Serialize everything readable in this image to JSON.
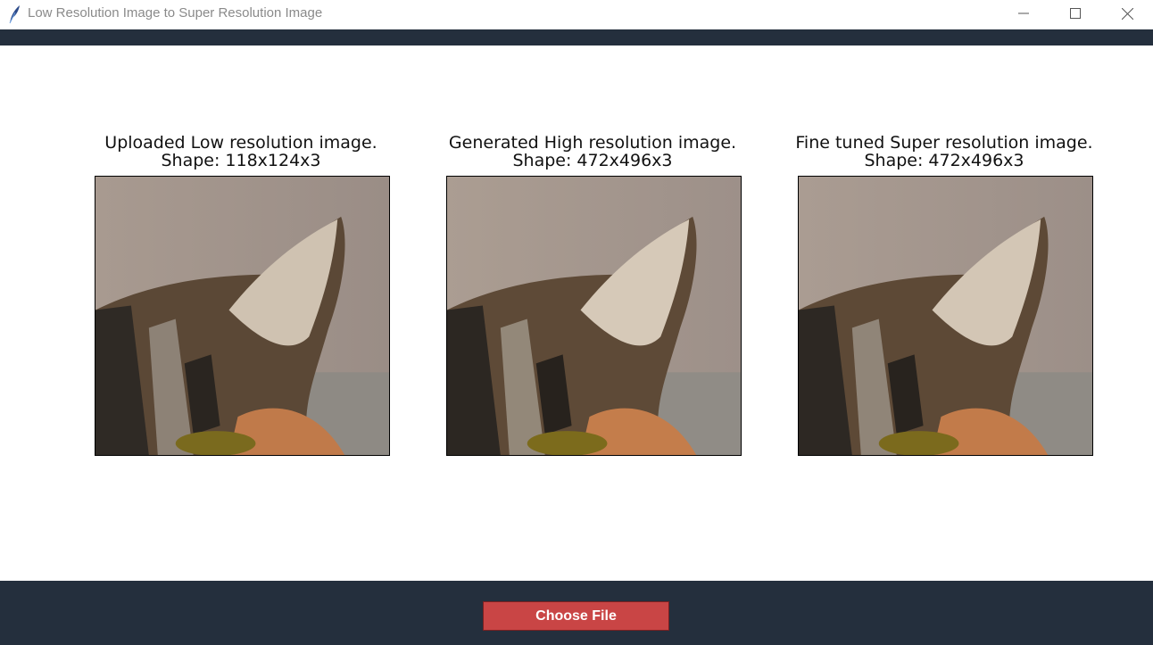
{
  "window": {
    "title": "Low Resolution Image to Super Resolution Image",
    "controls": {
      "minimize_icon": "minimize-icon",
      "maximize_icon": "maximize-icon",
      "close_icon": "close-icon"
    },
    "app_icon": "feather-icon"
  },
  "panels": [
    {
      "caption_line1": "Uploaded Low resolution image.",
      "caption_line2": "Shape: 118x124x3",
      "image": "cat-ear-low-res"
    },
    {
      "caption_line1": "Generated High resolution image.",
      "caption_line2": "Shape: 472x496x3",
      "image": "cat-ear-high-res"
    },
    {
      "caption_line1": "Fine tuned Super resolution image.",
      "caption_line2": "Shape: 472x496x3",
      "image": "cat-ear-super-res"
    }
  ],
  "footer": {
    "choose_file_label": "Choose File"
  },
  "colors": {
    "dark_band": "#242f3d",
    "button": "#c94545"
  }
}
